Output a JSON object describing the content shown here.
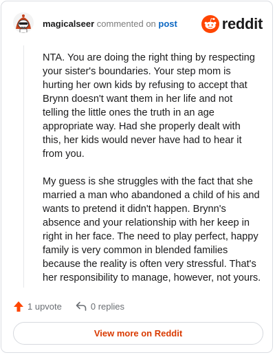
{
  "comment": {
    "username": "magicalseer",
    "action_text": "commented on",
    "post_link": "post",
    "paragraphs": [
      "NTA. You are doing the right thing by respecting your sister's boundaries. Your step mom is hurting her own kids by refusing to accept that Brynn doesn't want them in her life and not telling the little ones the truth in an age appropriate way. Had she properly dealt with this, her kids would never have had to hear it from you.",
      "My guess is she struggles with the fact that she married a man who abandoned a child of his and wants to pretend it didn't happen. Brynn's absence and your relationship with her keep in right in her face. The need to play perfect, happy family is very common in blended families because the reality is often very stressful. That's her responsibility to manage, however, not yours."
    ]
  },
  "brand": {
    "name": "reddit",
    "accent_color": "#ff4500",
    "link_color": "#0a66c2"
  },
  "actions": {
    "upvote_label": "1 upvote",
    "replies_label": "0 replies"
  },
  "footer": {
    "view_more_label": "View more on Reddit"
  },
  "icons": {
    "avatar": "snoo-avatar-icon",
    "logo": "reddit-snoo-icon",
    "upvote": "upvote-arrow-icon",
    "reply": "reply-arrow-icon"
  }
}
